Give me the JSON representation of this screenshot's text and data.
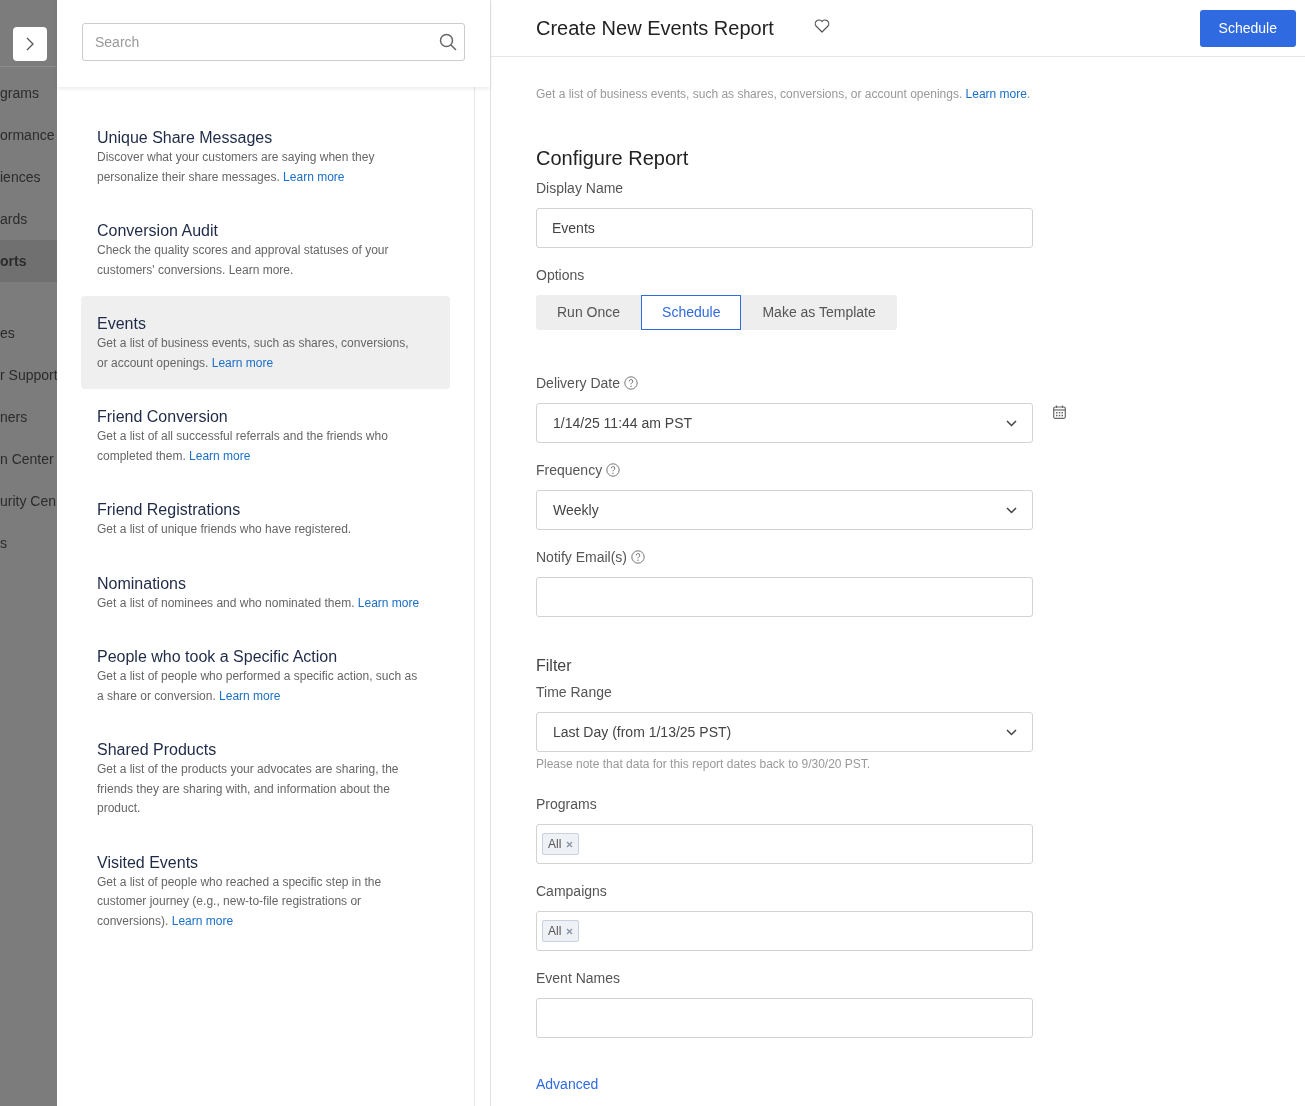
{
  "nav": {
    "groups": [
      [
        {
          "label": "grams",
          "selected": false
        },
        {
          "label": "ormance",
          "selected": false
        },
        {
          "label": "iences",
          "selected": false
        },
        {
          "label": "ards",
          "selected": false
        },
        {
          "label": "orts",
          "selected": true
        }
      ],
      [
        {
          "label": "es",
          "selected": false
        },
        {
          "label": "r Support",
          "selected": false
        },
        {
          "label": "ners",
          "selected": false
        },
        {
          "label": "n Center",
          "selected": false
        },
        {
          "label": "urity Cen",
          "selected": false
        },
        {
          "label": "s",
          "selected": false
        }
      ]
    ]
  },
  "search": {
    "placeholder": "Search"
  },
  "reports": [
    {
      "title": "Unique Share Messages",
      "description": "Discover what your customers are saying when they personalize their share messages.",
      "link": "Learn more",
      "selected": false
    },
    {
      "title": "Conversion Audit",
      "description": "Check the quality scores and approval statuses of your customers' conversions. Learn more.",
      "selected": false
    },
    {
      "title": "Events",
      "description": "Get a list of business events, such as shares, conversions, or account openings.",
      "link": "Learn more",
      "selected": true
    },
    {
      "title": "Friend Conversion",
      "description": "Get a list of all successful referrals and the friends who completed them.",
      "link": "Learn more",
      "selected": false
    },
    {
      "title": "Friend Registrations",
      "description": "Get a list of unique friends who have registered.",
      "selected": false
    },
    {
      "title": "Nominations",
      "description": "Get a list of nominees and who nominated them.",
      "link": "Learn more",
      "selected": false
    },
    {
      "title": "People who took a Specific Action",
      "description": "Get a list of people who performed a specific action, such as a share or conversion.",
      "link": "Learn more",
      "selected": false
    },
    {
      "title": "Shared Products",
      "description": "Get a list of the products your advocates are sharing, the friends they are sharing with, and information about the product.",
      "selected": false
    },
    {
      "title": "Visited Events",
      "description": "Get a list of people who reached a specific step in the customer journey (e.g., new-to-file registrations or conversions).",
      "link": "Learn more",
      "selected": false
    }
  ],
  "header": {
    "title": "Create New Events Report",
    "favorite": false,
    "action": "Schedule"
  },
  "intro": {
    "text": "Get a list of business events, such as shares, conversions, or account openings.",
    "link": "Learn more",
    "suffix": "."
  },
  "configure": {
    "heading": "Configure Report",
    "fields": [
      {
        "kind": "text",
        "label": "Display Name",
        "value": "Events"
      },
      {
        "kind": "segmented",
        "label": "Options",
        "options": [
          {
            "label": "Run Once",
            "selected": false
          },
          {
            "label": "Schedule",
            "selected": true
          },
          {
            "label": "Make as Template",
            "selected": false
          }
        ]
      },
      {
        "kind": "select",
        "label": "Delivery Date",
        "help": true,
        "value": "1/14/25 11:44 am PST",
        "calendar": true
      },
      {
        "kind": "select",
        "label": "Frequency",
        "help": true,
        "value": "Weekly"
      },
      {
        "kind": "text",
        "label": "Notify Email(s)",
        "help": true
      }
    ]
  },
  "filter": {
    "heading": "Filter",
    "fields": [
      {
        "kind": "select",
        "label": "Time Range",
        "value": "Last Day (from 1/13/25 PST)",
        "hint": "Please note that data for this report dates back to 9/30/20 PST."
      },
      {
        "kind": "tags",
        "label": "Programs",
        "tags": [
          "All"
        ]
      },
      {
        "kind": "tags",
        "label": "Campaigns",
        "tags": [
          "All"
        ]
      },
      {
        "kind": "text",
        "label": "Event Names"
      }
    ]
  },
  "advanced": "Advanced"
}
